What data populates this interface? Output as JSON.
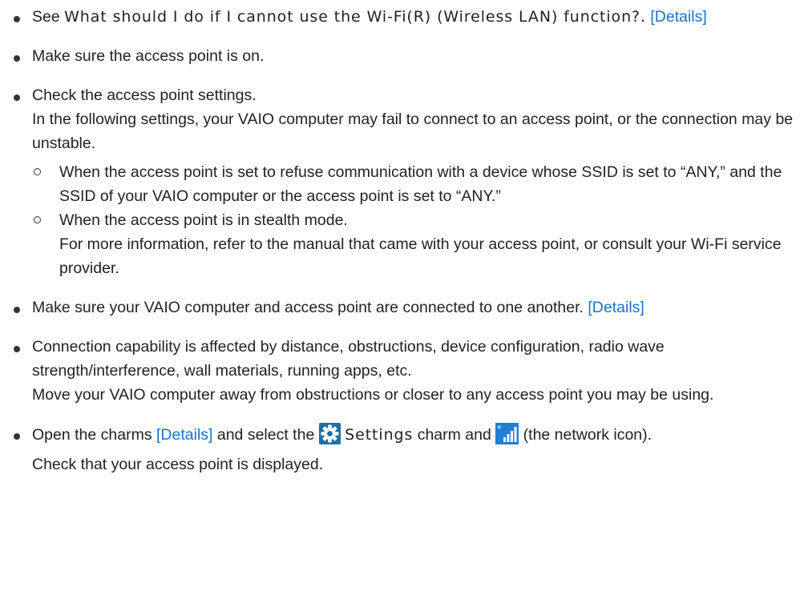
{
  "items": [
    {
      "see_prefix": "See ",
      "title": "What should I do if I cannot use the Wi-Fi(R) (Wireless LAN) function?.",
      "link": "[Details]"
    },
    {
      "text": "Make sure the access point is on."
    },
    {
      "line1": "Check the access point settings.",
      "line2": "In the following settings, your VAIO computer may fail to connect to an access point, or the connection may be unstable.",
      "sub": [
        {
          "text": "When the access point is set to refuse communication with a device whose SSID is set to “ANY,” and the SSID of your VAIO computer or the access point is set to “ANY.”"
        },
        {
          "line1": "When the access point is in stealth mode.",
          "line2": "For more information, refer to the manual that came with your access point, or consult your Wi-Fi service provider."
        }
      ]
    },
    {
      "text": "Make sure your VAIO computer and access point are connected to one another.",
      "link": "[Details]"
    },
    {
      "line1": "Connection capability is affected by distance, obstructions, device configuration, radio wave strength/interference, wall materials, running apps, etc.",
      "line2": "Move your VAIO computer away from obstructions or closer to any access point you may be using."
    },
    {
      "t1": "Open the charms ",
      "link": "[Details]",
      "t2": " and select the ",
      "settings_label": "Settings",
      "t3": " charm and ",
      "t4": " (the network icon).",
      "line2": "Check that your access point is displayed.",
      "settings_icon": "gear-icon",
      "network_icon": "network-signal-icon"
    }
  ],
  "colors": {
    "text": "#222222",
    "link": "#1a73c9",
    "charm_tile": "#1b6fa8",
    "network_tile": "#1f7fd0"
  }
}
